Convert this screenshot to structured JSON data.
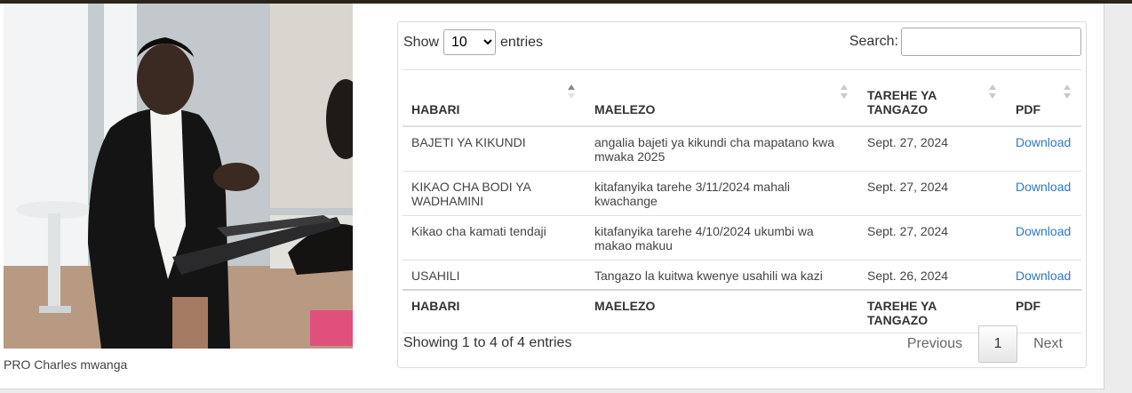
{
  "photo": {
    "caption": "PRO Charles mwanga",
    "subject": "man-presenting-with-laptop"
  },
  "controls": {
    "show_label": "Show",
    "entries_label": "entries",
    "page_length": "10",
    "search_label": "Search:",
    "search_value": ""
  },
  "table": {
    "headers": {
      "habari": "HABARI",
      "maelezo": "MAELEZO",
      "tarehe": "TAREHE YA TANGAZO",
      "pdf": "PDF"
    },
    "rows": [
      {
        "habari": "BAJETI YA KIKUNDI",
        "maelezo": "angalia bajeti ya kikundi cha mapatano kwa mwaka 2025",
        "tarehe": "Sept. 27, 2024",
        "pdf": "Download"
      },
      {
        "habari": "KIKAO CHA BODI YA WADHAMINI",
        "maelezo": "kitafanyika tarehe 3/11/2024 mahali kwachange",
        "tarehe": "Sept. 27, 2024",
        "pdf": "Download"
      },
      {
        "habari": "Kikao cha kamati tendaji",
        "maelezo": "kitafanyika tarehe 4/10/2024 ukumbi wa makao makuu",
        "tarehe": "Sept. 27, 2024",
        "pdf": "Download"
      },
      {
        "habari": "USAHILI",
        "maelezo": "Tangazo la kuitwa kwenye usahili wa kazi",
        "tarehe": "Sept. 26, 2024",
        "pdf": "Download"
      }
    ]
  },
  "footer": {
    "info": "Showing 1 to 4 of 4 entries",
    "previous": "Previous",
    "current_page": "1",
    "next": "Next"
  },
  "colors": {
    "link": "#2a78c6",
    "topbar": "#2b2418"
  }
}
